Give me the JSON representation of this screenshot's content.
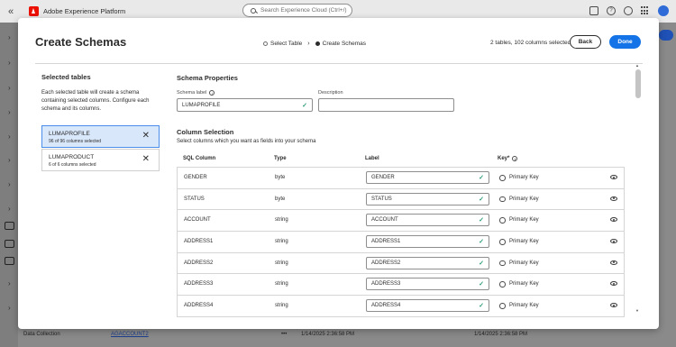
{
  "app": {
    "title": "Adobe Experience Platform",
    "search_placeholder": "Search Experience Cloud (Ctrl+/)",
    "brand_color": "#eb1000",
    "notification_badge": ""
  },
  "background": {
    "sidebar_bottom_label": "Data Collection",
    "row_link": "AGACCOUNT2",
    "row_dots": "•••",
    "row_date1": "1/14/2025 2:36:58 PM",
    "row_date2": "1/14/2025 2:36:58 PM"
  },
  "modal": {
    "title": "Create Schemas",
    "steps": [
      {
        "label": "Select Table",
        "state": "done"
      },
      {
        "label": "Create Schemas",
        "state": "current"
      }
    ],
    "step_separator": "›",
    "selection_summary": "2 tables, 102 columns selected",
    "back_label": "Back",
    "done_label": "Done",
    "accent_color": "#1473e6"
  },
  "left_panel": {
    "heading": "Selected tables",
    "description": "Each selected table will create a schema containing selected columns. Configure each schema and its columns.",
    "tables": [
      {
        "name": "LUMAPROFILE",
        "count": "96 of 96 columns selected",
        "selected": true
      },
      {
        "name": "LUMAPRODUCT",
        "count": "6 of 6 columns selected",
        "selected": false
      }
    ]
  },
  "schema_properties": {
    "heading": "Schema Properties",
    "label_field_label": "Schema label",
    "label_value": "LUMAPROFILE",
    "description_field_label": "Description",
    "description_value": ""
  },
  "column_selection": {
    "heading": "Column Selection",
    "subtitle": "Select columns which you want as fields into your schema",
    "headers": {
      "sql": "SQL Column",
      "type": "Type",
      "label": "Label",
      "key": "Key*"
    },
    "key_option_label": "Primary Key",
    "rows": [
      {
        "sql": "GENDER",
        "type": "byte",
        "label": "GENDER"
      },
      {
        "sql": "STATUS",
        "type": "byte",
        "label": "STATUS"
      },
      {
        "sql": "ACCOUNT",
        "type": "string",
        "label": "ACCOUNT"
      },
      {
        "sql": "ADDRESS1",
        "type": "string",
        "label": "ADDRESS1"
      },
      {
        "sql": "ADDRESS2",
        "type": "string",
        "label": "ADDRESS2"
      },
      {
        "sql": "ADDRESS3",
        "type": "string",
        "label": "ADDRESS3"
      },
      {
        "sql": "ADDRESS4",
        "type": "string",
        "label": "ADDRESS4"
      }
    ]
  }
}
